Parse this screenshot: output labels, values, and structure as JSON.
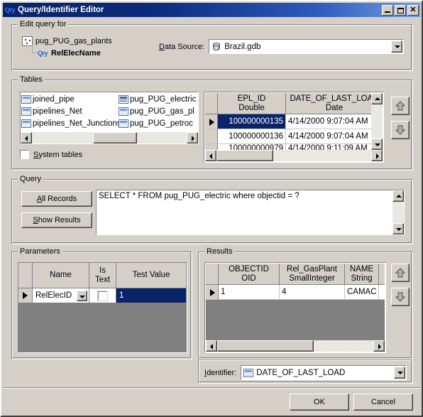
{
  "window": {
    "title": "Query/Identifier Editor",
    "title_icon": "Qry",
    "minimize_label": "_",
    "maximize_label": "□",
    "close_label": "✕"
  },
  "edit_query_for": {
    "legend": "Edit query for",
    "tree": [
      {
        "label": "pug_PUG_gas_plants",
        "icon": "point-feature-icon",
        "bold": false
      },
      {
        "label": "RelElecName",
        "icon": "qry-icon",
        "icon_text": "Qry",
        "bold": true
      }
    ],
    "data_source": {
      "label": "Data Source:",
      "label_accel": "D",
      "value": "Brazil.gdb",
      "icon": "database-icon"
    }
  },
  "tables": {
    "legend": "Tables",
    "list_left": [
      {
        "label": "joined_pipe",
        "icon": "table-icon"
      },
      {
        "label": "pipelines_Net",
        "icon": "table-icon"
      },
      {
        "label": "pipelines_Net_Junctions",
        "icon": "table-icon"
      }
    ],
    "list_right": [
      {
        "label": "pug_PUG_electric",
        "icon": "table-icon-selected"
      },
      {
        "label": "pug_PUG_gas_pl",
        "icon": "table-icon"
      },
      {
        "label": "pug_PUG_petroc",
        "icon": "table-icon"
      }
    ],
    "system_tables": {
      "label": "System tables",
      "label_accel": "S",
      "checked": false
    },
    "preview_grid": {
      "columns": [
        {
          "name": "EPL_ID",
          "type": "Double"
        },
        {
          "name": "DATE_OF_LAST_LOAD",
          "type": "Date"
        }
      ],
      "rows": [
        {
          "current": true,
          "cells": [
            "100000000135",
            "4/14/2000 9:07:04 AM"
          ],
          "selected_cell": 0
        },
        {
          "current": false,
          "cells": [
            "100000000136",
            "4/14/2000 9:07:04 AM"
          ],
          "selected_cell": -1
        },
        {
          "current": false,
          "cells": [
            "100000000979",
            "4/14/2000 9:11:09 AM"
          ],
          "selected_cell": -1
        }
      ]
    },
    "move_up_button": "move-up",
    "move_down_button": "move-down"
  },
  "query": {
    "legend": "Query",
    "all_records_label": "All Records",
    "all_records_accel": "A",
    "show_results_label": "Show Results",
    "show_results_accel": "S",
    "sql": "SELECT * FROM pug_PUG_electric where objectid = ?"
  },
  "parameters": {
    "legend": "Parameters",
    "columns": [
      "",
      "Name",
      "Is\nText",
      "Test Value"
    ],
    "column_name": "Name",
    "column_istext_line1": "Is",
    "column_istext_line2": "Text",
    "column_testvalue": "Test Value",
    "rows": [
      {
        "current": true,
        "name": "RelElecID",
        "is_text": false,
        "test_value": "1",
        "test_value_selected": true
      }
    ]
  },
  "results": {
    "legend": "Results",
    "columns": [
      {
        "name": "OBJECTID",
        "type": "OID"
      },
      {
        "name": "Rel_GasPlant",
        "type": "SmallInteger"
      },
      {
        "name": "NAME",
        "type": "String"
      }
    ],
    "rows": [
      {
        "current": true,
        "cells": [
          "1",
          "4",
          "CAMAC"
        ]
      }
    ]
  },
  "identifier": {
    "label": "Identifier:",
    "label_accel": "I",
    "value": "DATE_OF_LAST_LOAD",
    "icon": "table-icon"
  },
  "footer": {
    "ok_label": "OK",
    "cancel_label": "Cancel"
  },
  "colors": {
    "titlebar_start": "#08246b",
    "titlebar_end": "#6f9ce0",
    "face": "#d4d0c8",
    "selection": "#0a246a",
    "grid_empty": "#808080"
  }
}
